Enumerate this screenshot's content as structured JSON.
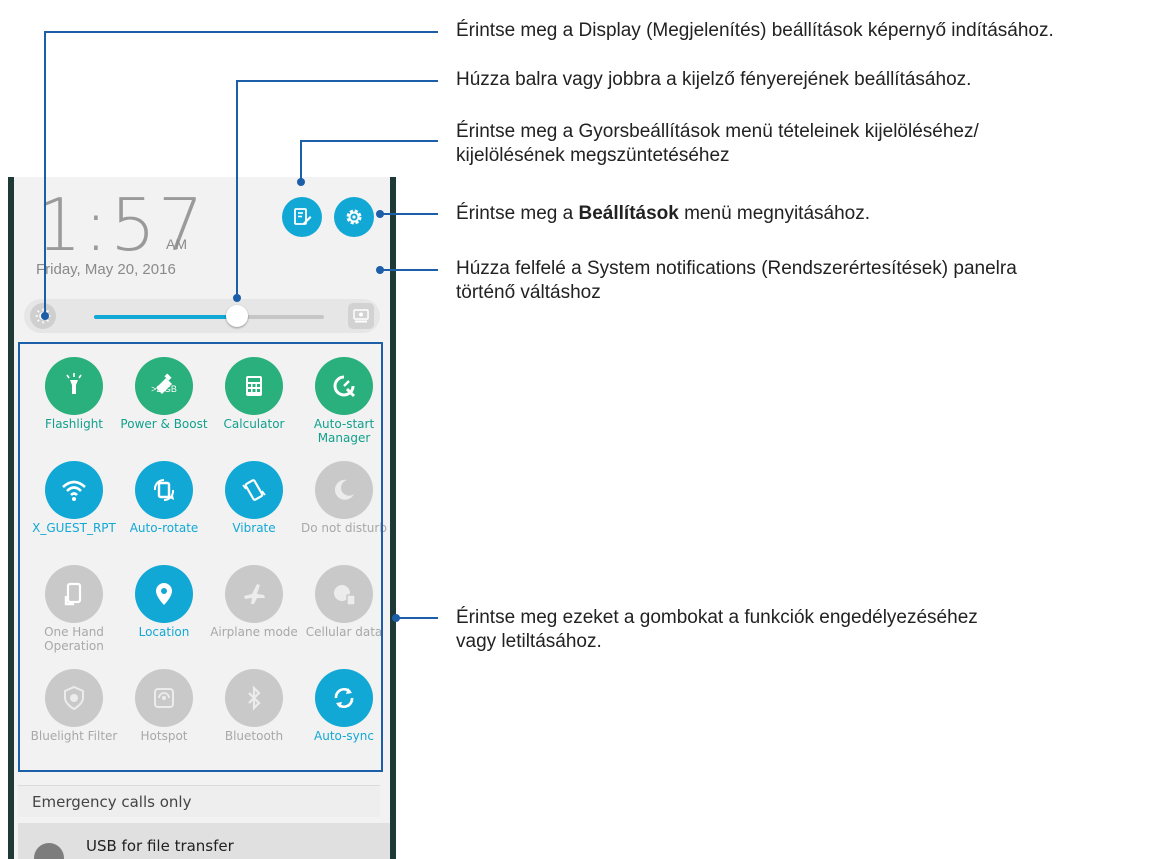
{
  "status": {
    "time": "1:57",
    "ampm": "AM",
    "date": "Friday, May 20, 2016"
  },
  "brightness": {
    "level": 0.62
  },
  "tiles": [
    {
      "label": "Flashlight",
      "state": "green",
      "icon": "flashlight-icon"
    },
    {
      "label": "Power & Boost",
      "sub": ">2 GB",
      "state": "green",
      "icon": "boost-icon"
    },
    {
      "label": "Calculator",
      "state": "green",
      "icon": "calculator-icon"
    },
    {
      "label": "Auto-start Manager",
      "state": "green",
      "icon": "auto-start-icon"
    },
    {
      "label": "X_GUEST_RPT",
      "state": "on",
      "icon": "wifi-icon"
    },
    {
      "label": "Auto-rotate",
      "state": "on",
      "icon": "rotate-icon"
    },
    {
      "label": "Vibrate",
      "state": "on",
      "icon": "vibrate-icon"
    },
    {
      "label": "Do not disturb",
      "state": "off",
      "icon": "moon-icon"
    },
    {
      "label": "One Hand Operation",
      "state": "off",
      "icon": "one-hand-icon"
    },
    {
      "label": "Location",
      "state": "on",
      "icon": "location-icon"
    },
    {
      "label": "Airplane mode",
      "state": "off",
      "icon": "airplane-icon"
    },
    {
      "label": "Cellular data",
      "state": "off",
      "icon": "cellular-data-icon"
    },
    {
      "label": "Bluelight Filter",
      "state": "off",
      "icon": "bluelight-icon"
    },
    {
      "label": "Hotspot",
      "state": "off",
      "icon": "hotspot-icon"
    },
    {
      "label": "Bluetooth",
      "state": "off",
      "icon": "bluetooth-icon"
    },
    {
      "label": "Auto-sync",
      "state": "on",
      "icon": "sync-icon"
    }
  ],
  "emergency": "Emergency calls only",
  "notification": {
    "title": "USB for file transfer"
  },
  "callouts": {
    "display": "Érintse meg a Display (Megjelenítés) beállítások képernyő indításához.",
    "brightness": "Húzza balra vagy jobbra a kijelző fényerejének beállításához.",
    "edit_line1": "Érintse meg a Gyorsbeállítások menü tételeinek kijelöléséhez/",
    "edit_line2": "kijelölésének megszüntetéséhez",
    "settings_pre": "Érintse meg a ",
    "settings_bold": "Beállítások",
    "settings_post": " menü megnyitásához.",
    "swipe_line1": "Húzza felfelé a System notifications (Rendszerértesítések) panelra",
    "swipe_line2": "történő váltáshoz",
    "toggle_line1": "Érintse meg ezeket a gombokat a funkciók engedélyezéséhez",
    "toggle_line2": "vagy letiltásához."
  },
  "colors": {
    "accent": "#12a8d5",
    "green": "#2ab07c",
    "callout": "#1c5ea8",
    "disabled": "#c9c9c9"
  }
}
